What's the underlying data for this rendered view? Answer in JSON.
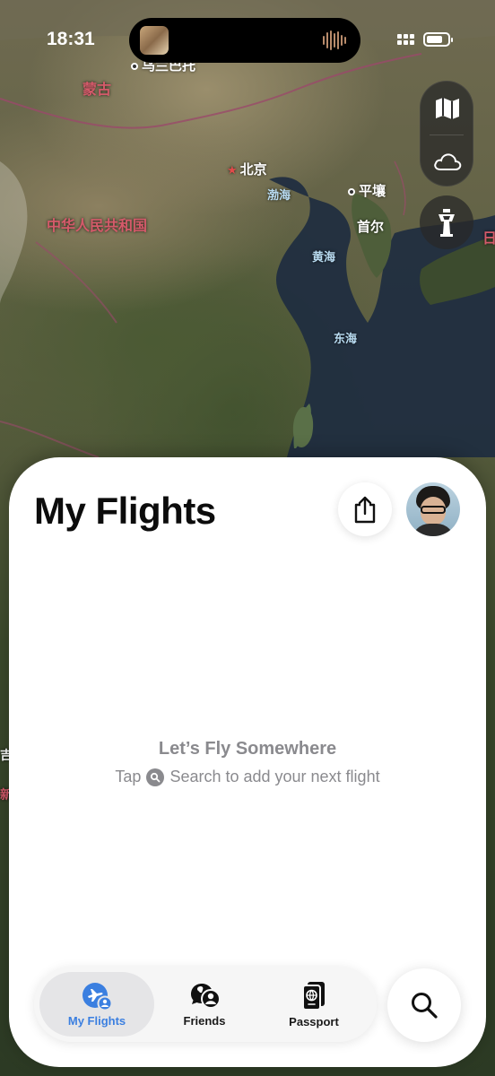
{
  "status_bar": {
    "time": "18:31"
  },
  "map": {
    "labels": {
      "mongolia": "蒙古",
      "ulaanbaatar": "乌兰巴托",
      "beijing": "北京",
      "china": "中华人民共和国",
      "bohai": "渤海",
      "pyongyang": "平壤",
      "seoul": "首尔",
      "yellow_sea": "黄海",
      "east_sea": "东海",
      "japan_partial": "日",
      "left_partial_1": "吉",
      "left_partial_2": "新"
    },
    "controls": {
      "map_mode_icon": "map-icon",
      "weather_icon": "cloud-icon",
      "tracking_icon": "control-tower-icon"
    }
  },
  "sheet": {
    "title": "My Flights",
    "empty_state": {
      "title": "Let’s Fly Somewhere",
      "hint_before": "Tap",
      "hint_after": "Search to add your next flight"
    }
  },
  "tab_bar": {
    "tabs": [
      {
        "label": "My Flights",
        "icon": "plane-person-icon",
        "active": true
      },
      {
        "label": "Friends",
        "icon": "friends-icon",
        "active": false
      },
      {
        "label": "Passport",
        "icon": "passport-icon",
        "active": false
      }
    ]
  },
  "colors": {
    "accent": "#3b7fe0",
    "secondary_text": "#8a8a8e",
    "map_label_red": "#d45a6a"
  }
}
